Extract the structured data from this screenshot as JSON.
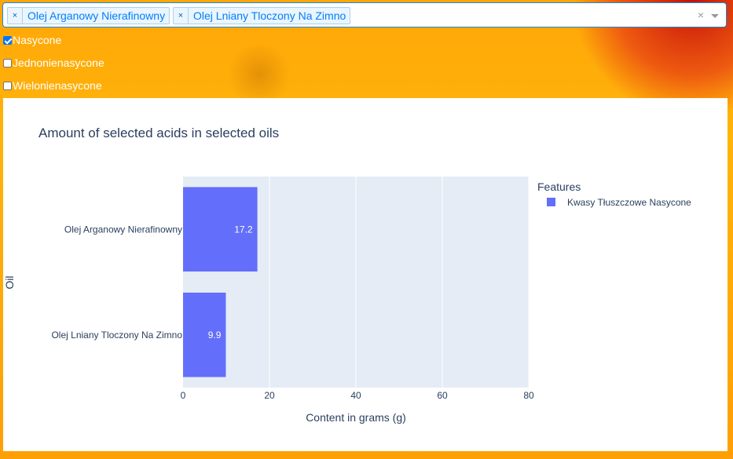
{
  "filter": {
    "selected_oils": [
      "Olej Arganowy Nierafinowny",
      "Olej Lniany Tloczony Na Zimno"
    ],
    "clear_symbol": "×",
    "remove_symbol": "×"
  },
  "checklist": [
    {
      "label": "Nasycone",
      "checked": true
    },
    {
      "label": "Jednonienasycone",
      "checked": false
    },
    {
      "label": "Wielonienasycone",
      "checked": false
    }
  ],
  "chart_data": {
    "type": "bar",
    "orientation": "horizontal",
    "title": "Amount of selected acids in selected oils",
    "xlabel": "Content in grams (g)",
    "ylabel": "Oil",
    "categories": [
      "Olej Arganowy Nierafinowny",
      "Olej Lniany Tloczony Na Zimno"
    ],
    "series": [
      {
        "name": "Kwasy Tłuszczowe Nasycone",
        "values": [
          17.2,
          9.9
        ],
        "color": "#636efa"
      }
    ],
    "xlim": [
      0,
      80
    ],
    "xticks": [
      0,
      20,
      40,
      60,
      80
    ],
    "legend_title": "Features",
    "legend_position": "right",
    "grid": true,
    "plot_bg": "#e5ecf6"
  }
}
